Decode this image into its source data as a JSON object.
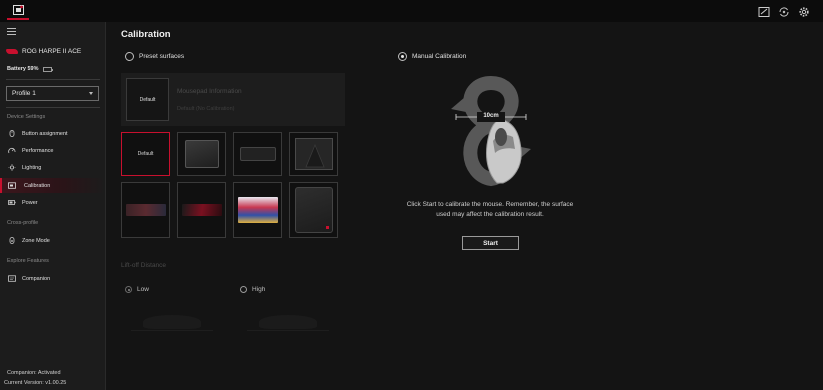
{
  "topbar": {
    "app_icon": "rog-armoury-icon",
    "icons": [
      "photo-edit-icon",
      "sync-icon",
      "settings-gear-icon"
    ]
  },
  "sidebar": {
    "device_name": "ROG HARPE II ACE",
    "battery_label": "Battery 59%",
    "battery_level": 0.59,
    "profile": "Profile 1",
    "sections": {
      "device_settings": "Device Settings",
      "cross_profile": "Cross-profile",
      "explore": "Explore Features"
    },
    "items": [
      {
        "label": "Button assignment",
        "icon": "mouse-icon"
      },
      {
        "label": "Performance",
        "icon": "gauge-icon"
      },
      {
        "label": "Lighting",
        "icon": "lighting-icon"
      },
      {
        "label": "Calibration",
        "icon": "calibration-icon",
        "active": true
      },
      {
        "label": "Power",
        "icon": "battery-icon"
      },
      {
        "label": "Zone Mode",
        "icon": "zone-mode-icon"
      },
      {
        "label": "Companion",
        "icon": "companion-icon"
      }
    ],
    "companion_status": "Companion: Activated",
    "version": "Current Version: v1.00.25"
  },
  "main": {
    "title": "Calibration",
    "preset_label": "Preset surfaces",
    "manual_label": "Manual Calibration",
    "selected_mode": "manual",
    "pad_info": {
      "thumb_label": "Default",
      "title": "Mousepad Information",
      "subtitle": "Default (No Calibration)"
    },
    "surfaces": [
      {
        "label": "Default",
        "selected": true
      },
      {
        "label": ""
      },
      {
        "label": ""
      },
      {
        "label": ""
      },
      {
        "label": ""
      },
      {
        "label": ""
      },
      {
        "label": ""
      },
      {
        "label": ""
      }
    ],
    "liftoff": {
      "label": "Lift-off Distance",
      "low": "Low",
      "high": "High",
      "selected": "low"
    },
    "illustration_label": "10cm",
    "instruction": "Click Start to calibrate the mouse. Remember, the surface used may affect the calibration result.",
    "start_label": "Start"
  },
  "colors": {
    "accent": "#c8102e",
    "background": "#141414",
    "sidebar": "#1c1c1c",
    "battery": "#2dbb35"
  }
}
